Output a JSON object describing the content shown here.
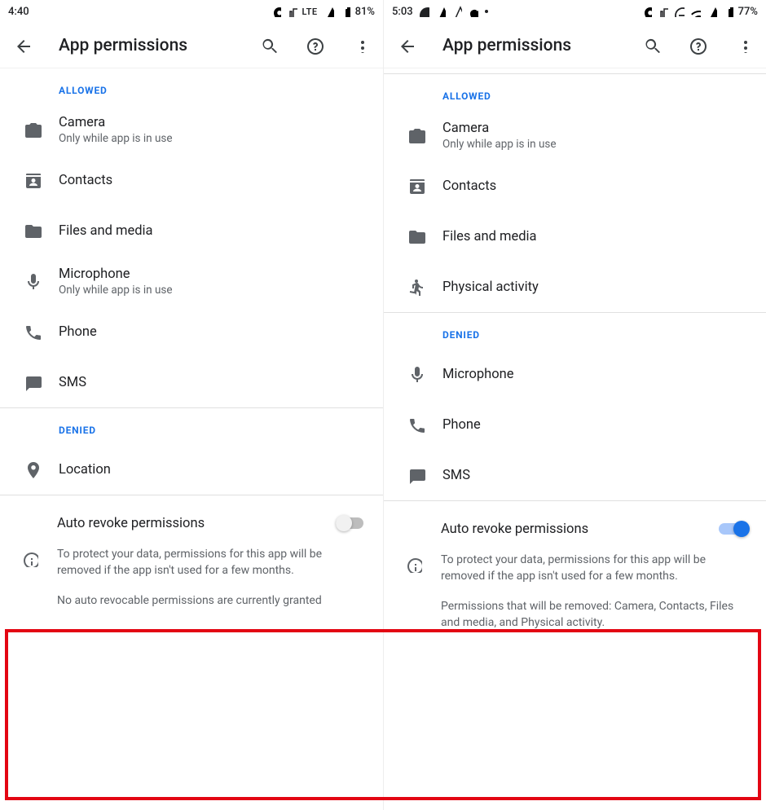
{
  "left": {
    "time": "4:40",
    "network_label": "LTE",
    "battery_text": "81%",
    "appbar_title": "App permissions",
    "section_allowed": "ALLOWED",
    "section_denied": "DENIED",
    "allowed": [
      {
        "title": "Camera",
        "sub": "Only while app is in use"
      },
      {
        "title": "Contacts",
        "sub": ""
      },
      {
        "title": "Files and media",
        "sub": ""
      },
      {
        "title": "Microphone",
        "sub": "Only while app is in use"
      },
      {
        "title": "Phone",
        "sub": ""
      },
      {
        "title": "SMS",
        "sub": ""
      }
    ],
    "denied": [
      {
        "title": "Location",
        "sub": ""
      }
    ],
    "revoke": {
      "title": "Auto revoke permissions",
      "toggle_on": false,
      "desc": "To protect your data, permissions for this app will be removed if the app isn't used for a few months.",
      "extra": "No auto revocable permissions are currently granted"
    }
  },
  "right": {
    "time": "5:03",
    "battery_text": "77%",
    "appbar_title": "App permissions",
    "section_allowed": "ALLOWED",
    "section_denied": "DENIED",
    "allowed": [
      {
        "title": "Camera",
        "sub": "Only while app is in use"
      },
      {
        "title": "Contacts",
        "sub": ""
      },
      {
        "title": "Files and media",
        "sub": ""
      },
      {
        "title": "Physical activity",
        "sub": ""
      }
    ],
    "denied": [
      {
        "title": "Microphone",
        "sub": ""
      },
      {
        "title": "Phone",
        "sub": ""
      },
      {
        "title": "SMS",
        "sub": ""
      }
    ],
    "revoke": {
      "title": "Auto revoke permissions",
      "toggle_on": true,
      "desc": "To protect your data, permissions for this app will be removed if the app isn't used for a few months.",
      "extra": "Permissions that will be removed: Camera, Contacts, Files and media, and Physical activity."
    }
  }
}
